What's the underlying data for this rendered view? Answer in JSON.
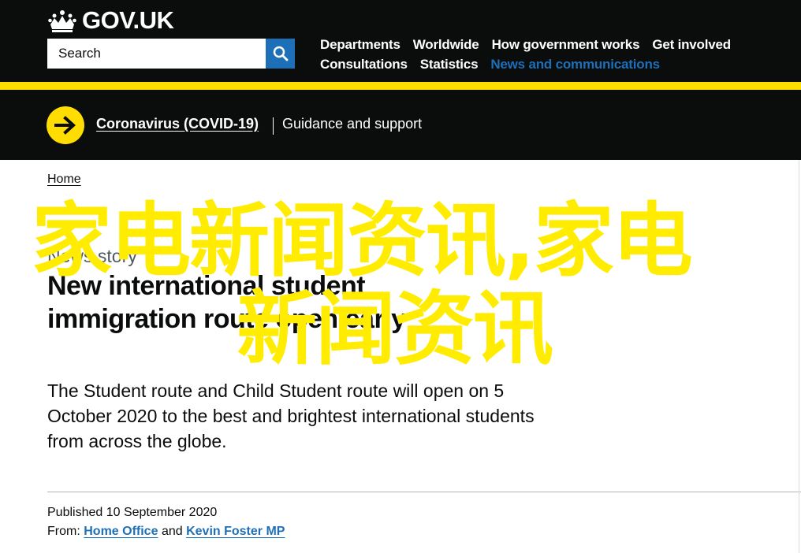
{
  "header": {
    "logo_text": "GOV.UK",
    "search_placeholder": "Search",
    "nav": [
      [
        "Departments",
        "Worldwide",
        "How government works",
        "Get involved"
      ],
      [
        "Consultations",
        "Statistics",
        "News and communications"
      ]
    ]
  },
  "covid": {
    "link": "Coronavirus (COVID-19)",
    "text": "Guidance and support"
  },
  "breadcrumb": "Home",
  "caption": "News story",
  "title": "New international student immigration route open early",
  "lead": "The Student route and Child Student route will open on 5 October 2020 to the best and brightest international students from across the globe.",
  "metadata": {
    "published": "Published 10 September 2020",
    "from_label": "From:",
    "org1": "Home Office",
    "and": "and",
    "org2": "Kevin Foster MP"
  },
  "watermark": {
    "line1": "家电新闻资讯,家电",
    "line2": "新闻资讯"
  },
  "colors": {
    "header_bg": "#0b0c0c",
    "accent_yellow": "#ffdd00",
    "link_blue": "#1d70b8",
    "watermark": "#ffec00"
  },
  "icons": [
    "crown-icon",
    "search-icon",
    "arrow-right-icon"
  ]
}
